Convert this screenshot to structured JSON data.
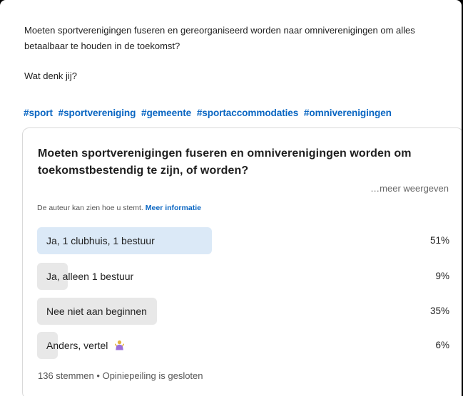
{
  "post": {
    "question_lead": "Moeten sportverenigingen fuseren en gereorganiseerd worden naar omniverenigingen om alles betaalbaar te houden in de toekomst?",
    "prompt": "Wat denk jij?",
    "hashtags": [
      "#sport",
      "#sportvereniging",
      "#gemeente",
      "#sportaccommodaties",
      "#omniverenigingen"
    ]
  },
  "poll": {
    "question": "Moeten sportverenigingen fuseren en omniverenigingen worden om toekomstbestendig te zijn, of worden?",
    "see_more": "…meer weergeven",
    "disclosure_text": "De auteur kan zien hoe u stemt.",
    "disclosure_link": "Meer informatie",
    "options": [
      {
        "label": "Ja, 1 clubhuis, 1 bestuur",
        "percent_text": "51%",
        "percent": 51,
        "selected": true
      },
      {
        "label": "Ja, alleen 1 bestuur",
        "percent_text": "9%",
        "percent": 9,
        "selected": false
      },
      {
        "label": "Nee niet aan beginnen",
        "percent_text": "35%",
        "percent": 35,
        "selected": false
      },
      {
        "label": "Anders, vertel",
        "percent_text": "6%",
        "percent": 6,
        "selected": false,
        "icon": "person-gesturing-icon"
      }
    ],
    "votes": "136 stemmen",
    "separator": "•",
    "status": "Opiniepeiling is gesloten"
  },
  "colors": {
    "link": "#0a66c2",
    "selected_fill": "#dbe9f7",
    "fill": "#e8e8e8"
  }
}
